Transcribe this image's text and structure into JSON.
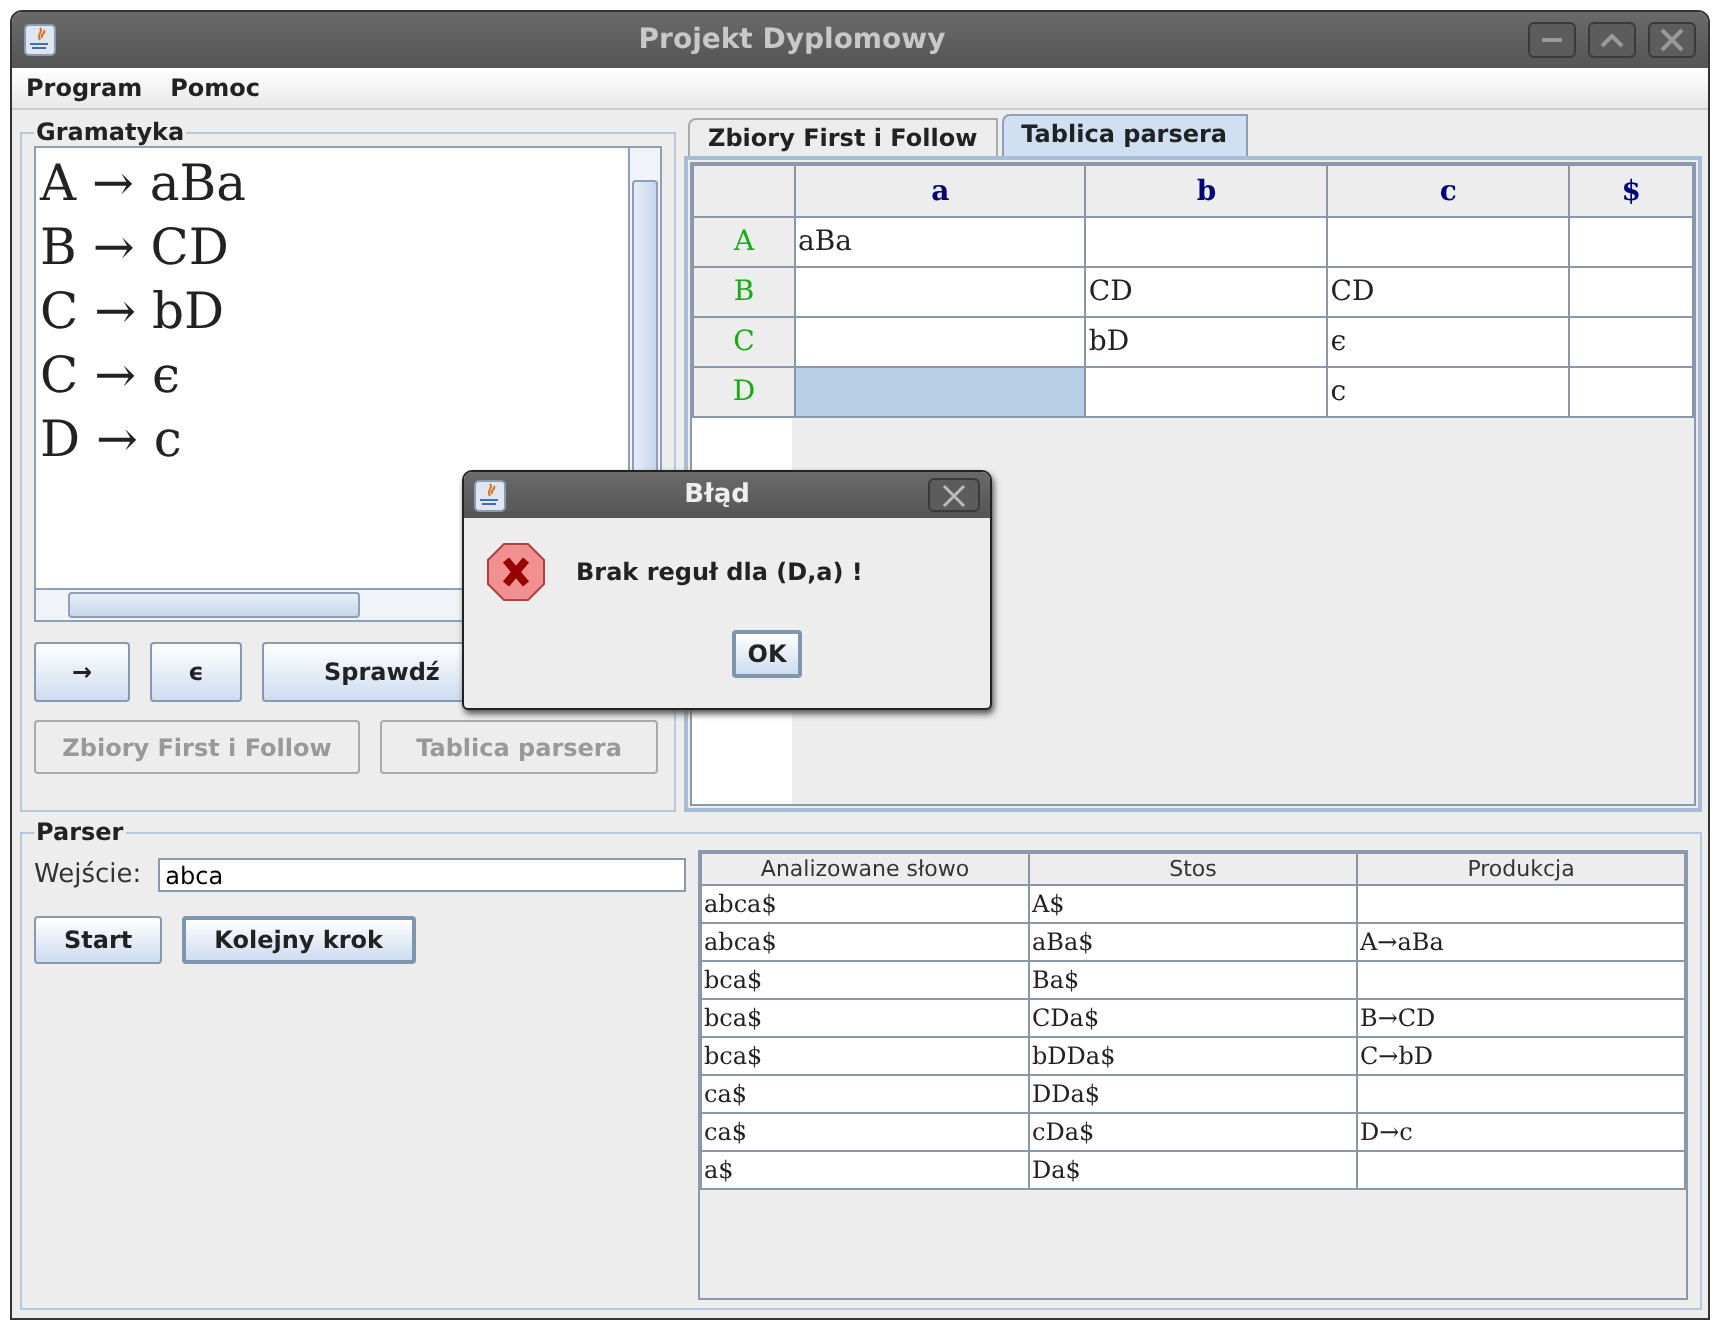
{
  "window": {
    "title": "Projekt Dyplomowy"
  },
  "menu": [
    "Program",
    "Pomoc"
  ],
  "grammar": {
    "title": "Gramatyka",
    "lines": [
      "A → aBa",
      "B → CD",
      "C → bD",
      "C → ϵ",
      "D → c"
    ],
    "buttons": [
      {
        "label": "→",
        "disabled": false
      },
      {
        "label": "ϵ",
        "disabled": false
      },
      {
        "label": "Sprawdź",
        "disabled": false
      }
    ],
    "actions": [
      {
        "label": "Zbiory First i Follow",
        "disabled": true
      },
      {
        "label": "Tablica parsera",
        "disabled": true
      }
    ]
  },
  "tabs": [
    {
      "label": "Zbiory First i Follow",
      "selected": false
    },
    {
      "label": "Tablica parsera",
      "selected": true
    }
  ],
  "parse_table": {
    "columns": [
      "a",
      "b",
      "c",
      "$"
    ],
    "rows": [
      {
        "header": "A",
        "cells": [
          {
            "text": "aBa",
            "selected": false
          },
          {
            "selected": false
          },
          {
            "selected": false
          },
          {
            "selected": false
          }
        ]
      },
      {
        "header": "B",
        "cells": [
          {
            "selected": false
          },
          {
            "text": "CD",
            "selected": false
          },
          {
            "text": "CD",
            "selected": false
          },
          {
            "selected": false
          }
        ]
      },
      {
        "header": "C",
        "cells": [
          {
            "selected": false
          },
          {
            "text": "bD",
            "selected": false
          },
          {
            "text": "ϵ",
            "selected": false
          },
          {
            "selected": false
          }
        ]
      },
      {
        "header": "D",
        "cells": [
          {
            "selected": true
          },
          {
            "selected": false
          },
          {
            "text": "c",
            "selected": false
          },
          {
            "selected": false
          }
        ]
      }
    ]
  },
  "parser": {
    "title": "Parser",
    "input_label": "Wejście:",
    "input_value": "abca",
    "buttons": [
      {
        "label": "Start",
        "focused": false
      },
      {
        "label": "Kolejny krok",
        "focused": true
      }
    ],
    "table": {
      "columns": [
        "Analizowane słowo",
        "Stos",
        "Produkcja"
      ],
      "rows": [
        {
          "word": "abca$",
          "stack": "A$"
        },
        {
          "word": "abca$",
          "stack": "aBa$",
          "production": "A→aBa"
        },
        {
          "word": "bca$",
          "stack": "Ba$"
        },
        {
          "word": "bca$",
          "stack": "CDa$",
          "production": "B→CD"
        },
        {
          "word": "bca$",
          "stack": "bDDa$",
          "production": "C→bD"
        },
        {
          "word": "ca$",
          "stack": "DDa$"
        },
        {
          "word": "ca$",
          "stack": "cDa$",
          "production": "D→c"
        },
        {
          "word": "a$",
          "stack": "Da$"
        }
      ]
    }
  },
  "dialog": {
    "title": "Błąd",
    "message": "Brak reguł dla (D,a) !",
    "button": "OK"
  }
}
